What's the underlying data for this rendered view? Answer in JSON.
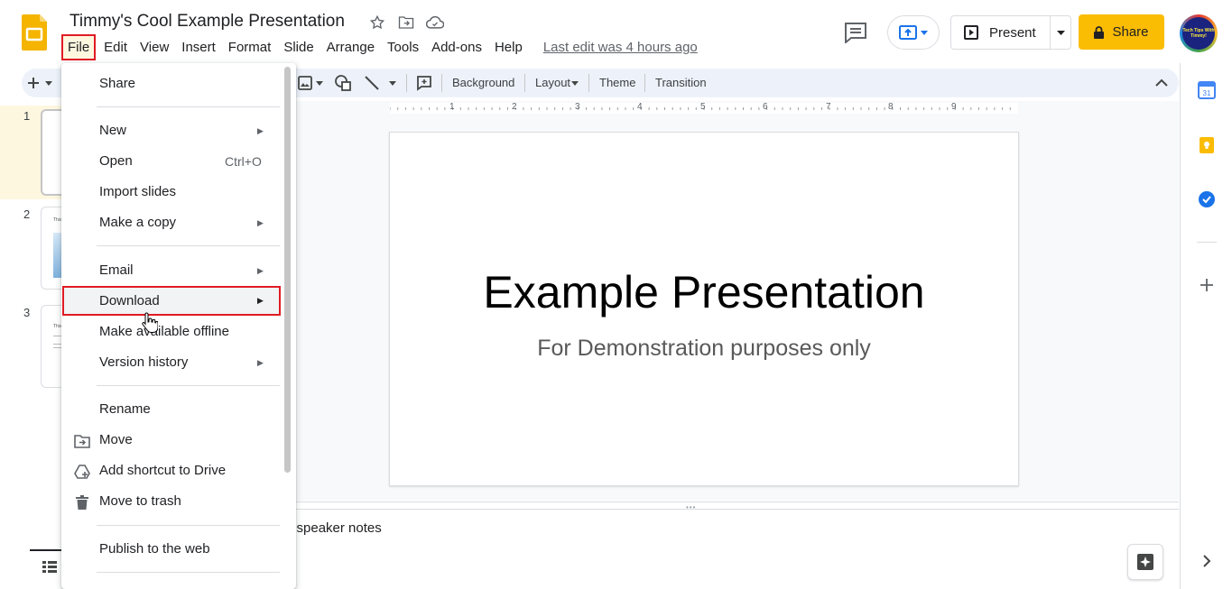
{
  "app": {
    "doc_title": "Timmy's Cool Example Presentation",
    "last_edit": "Last edit was 4 hours ago",
    "present_label": "Present",
    "share_label": "Share",
    "avatar_text": "Tech Tips With Timmy!",
    "accent_color": "#fbbc04",
    "highlight_color": "#e01b24"
  },
  "menubar": {
    "items": [
      "File",
      "Edit",
      "View",
      "Insert",
      "Format",
      "Slide",
      "Arrange",
      "Tools",
      "Add-ons",
      "Help"
    ]
  },
  "toolbar": {
    "background": "Background",
    "layout": "Layout",
    "theme": "Theme",
    "transition": "Transition"
  },
  "ruler": {
    "numbers": [
      "1",
      "2",
      "3",
      "4",
      "5",
      "6",
      "7",
      "8",
      "9"
    ]
  },
  "filmstrip": {
    "slides": [
      {
        "number": "1"
      },
      {
        "number": "2",
        "snippet": "This"
      },
      {
        "number": "3",
        "snippet": "This"
      }
    ]
  },
  "slide": {
    "title": "Example Presentation",
    "subtitle": "For Demonstration purposes only"
  },
  "notes": {
    "placeholder": "d speaker notes"
  },
  "file_menu": {
    "share": "Share",
    "new": "New",
    "open": "Open",
    "open_shortcut": "Ctrl+O",
    "import_slides": "Import slides",
    "make_copy": "Make a copy",
    "email": "Email",
    "download": "Download",
    "offline": "Make available offline",
    "version_history": "Version history",
    "rename": "Rename",
    "move": "Move",
    "add_shortcut": "Add shortcut to Drive",
    "trash": "Move to trash",
    "publish": "Publish to the web"
  },
  "side_panel": {
    "calendar_day": "31"
  }
}
